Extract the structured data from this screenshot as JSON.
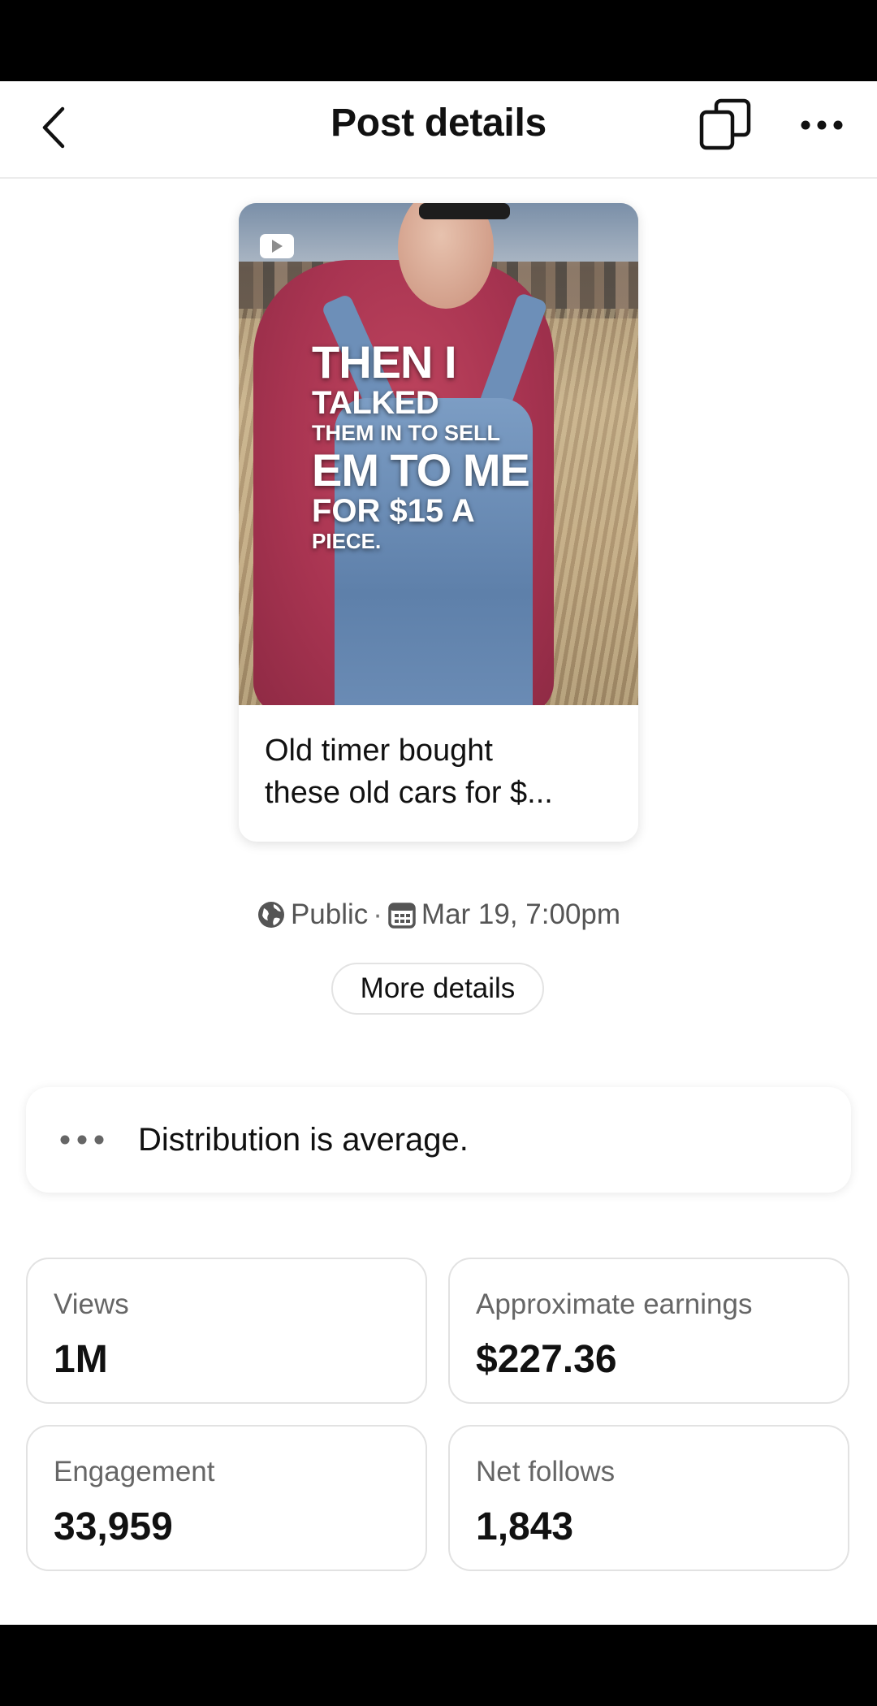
{
  "header": {
    "title": "Post details",
    "back_icon": "chevron-left-icon",
    "copy_icon": "copy-icon",
    "more_icon": "more-horizontal-icon"
  },
  "post": {
    "overlay_lines": [
      "THEN I",
      "TALKED",
      "THEM IN TO SELL",
      "EM TO ME",
      "FOR $15 A",
      "PIECE."
    ],
    "caption_line1": "Old timer bought",
    "caption_line2": "these old cars for $...",
    "video_icon": "youtube-icon"
  },
  "meta": {
    "visibility": "Public",
    "separator": "·",
    "date": "Mar 19, 7:00pm",
    "visibility_icon": "globe-icon",
    "date_icon": "calendar-icon"
  },
  "more_details_label": "More details",
  "distribution": {
    "text": "Distribution is average.",
    "icon": "ellipsis-icon"
  },
  "stats": [
    {
      "label": "Views",
      "value": "1M"
    },
    {
      "label": "Approximate earnings",
      "value": "$227.36"
    },
    {
      "label": "Engagement",
      "value": "33,959"
    },
    {
      "label": "Net follows",
      "value": "1,843"
    }
  ]
}
